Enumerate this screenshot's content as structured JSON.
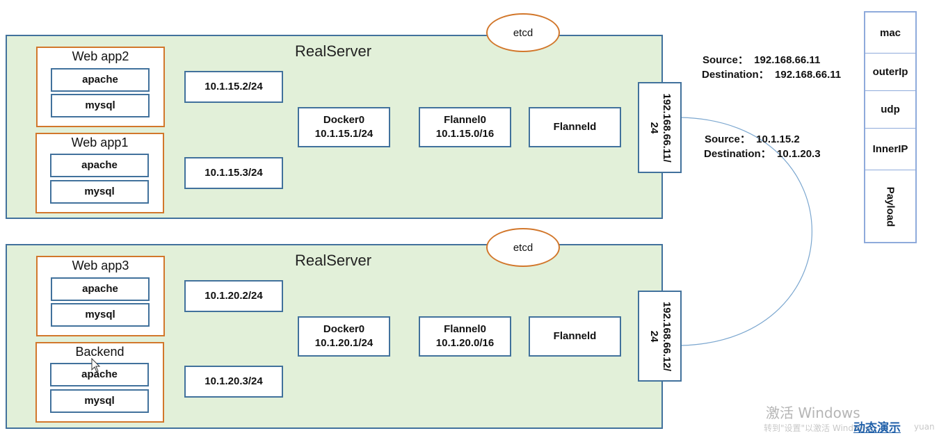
{
  "servers": [
    {
      "title": "RealServer",
      "etcd": "etcd",
      "apps": [
        {
          "title": "Web app2",
          "services": [
            "apache",
            "mysql"
          ]
        },
        {
          "title": "Web app1",
          "services": [
            "apache",
            "mysql"
          ]
        }
      ],
      "veth": [
        "10.1.15.2/24",
        "10.1.15.3/24"
      ],
      "docker0": {
        "name": "Docker0",
        "ip": "10.1.15.1/24"
      },
      "flannel0": {
        "name": "Flannel0",
        "ip": "10.1.15.0/16"
      },
      "flanneld": "Flanneld",
      "nic": {
        "line1": "192.168.66.11/",
        "line2": "24"
      }
    },
    {
      "title": "RealServer",
      "etcd": "etcd",
      "apps": [
        {
          "title": "Web app3",
          "services": [
            "apache",
            "mysql"
          ]
        },
        {
          "title": "Backend",
          "services": [
            "apache",
            "mysql"
          ]
        }
      ],
      "veth": [
        "10.1.20.2/24",
        "10.1.20.3/24"
      ],
      "docker0": {
        "name": "Docker0",
        "ip": "10.1.20.1/24"
      },
      "flannel0": {
        "name": "Flannel0",
        "ip": "10.1.20.0/16"
      },
      "flanneld": "Flanneld",
      "nic": {
        "line1": "192.168.66.12/",
        "line2": "24"
      }
    }
  ],
  "outer_header": {
    "source": "Source：  192.168.66.11",
    "destination": "Destination：  192.168.66.11"
  },
  "inner_header": {
    "source": "Source：  10.1.15.2",
    "destination": "Destination：  10.1.20.3"
  },
  "packet": [
    "mac",
    "outerIp",
    "udp",
    "InnerIP",
    "Payload"
  ],
  "watermark": {
    "line1": "激活 Windows",
    "line2": "转到\"设置\"以激活 Windows。",
    "demo_link": "动态演示",
    "tail": "yuan"
  },
  "colors": {
    "server_fill": "#e2f0d9",
    "border_blue": "#41719c",
    "app_border": "#d2772b",
    "link": "#1f5fa8"
  }
}
